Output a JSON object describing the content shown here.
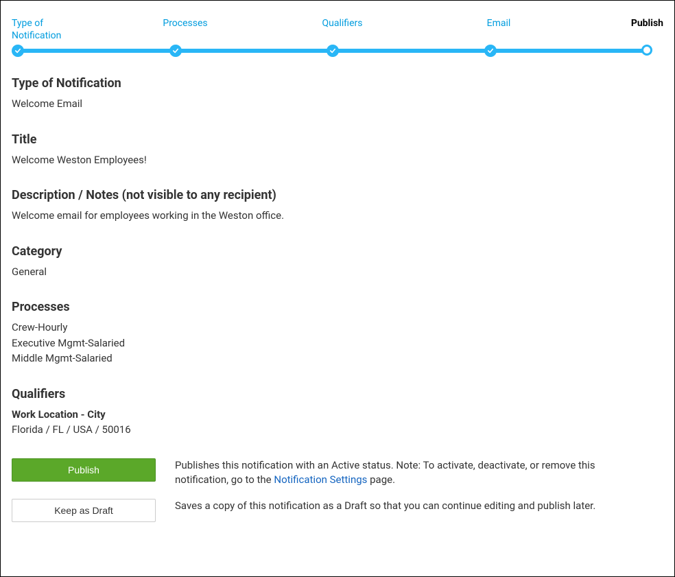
{
  "stepper": {
    "steps": [
      {
        "label": "Type of Notification",
        "state": "done"
      },
      {
        "label": "Processes",
        "state": "done"
      },
      {
        "label": "Qualifiers",
        "state": "done"
      },
      {
        "label": "Email",
        "state": "done"
      },
      {
        "label": "Publish",
        "state": "current"
      }
    ]
  },
  "sections": {
    "type_heading": "Type of Notification",
    "type_value": "Welcome Email",
    "title_heading": "Title",
    "title_value": "Welcome Weston Employees!",
    "desc_heading": "Description / Notes (not visible to any recipient)",
    "desc_value": "Welcome email for employees working in the Weston office.",
    "category_heading": "Category",
    "category_value": "General",
    "processes_heading": "Processes",
    "processes": [
      "Crew-Hourly",
      "Executive Mgmt-Salaried",
      "Middle Mgmt-Salaried"
    ],
    "qualifiers_heading": "Qualifiers",
    "qualifiers_sub": "Work Location - City",
    "qualifiers_value": "Florida / FL / USA / 50016"
  },
  "actions": {
    "publish_label": "Publish",
    "publish_desc_pre": "Publishes this notification with an Active status. Note: To activate, deactivate, or remove this notification, go to the ",
    "publish_link": "Notification Settings",
    "publish_desc_post": " page.",
    "draft_label": "Keep as Draft",
    "draft_desc": "Saves a copy of this notification as a Draft so that you can continue editing and publish later."
  }
}
